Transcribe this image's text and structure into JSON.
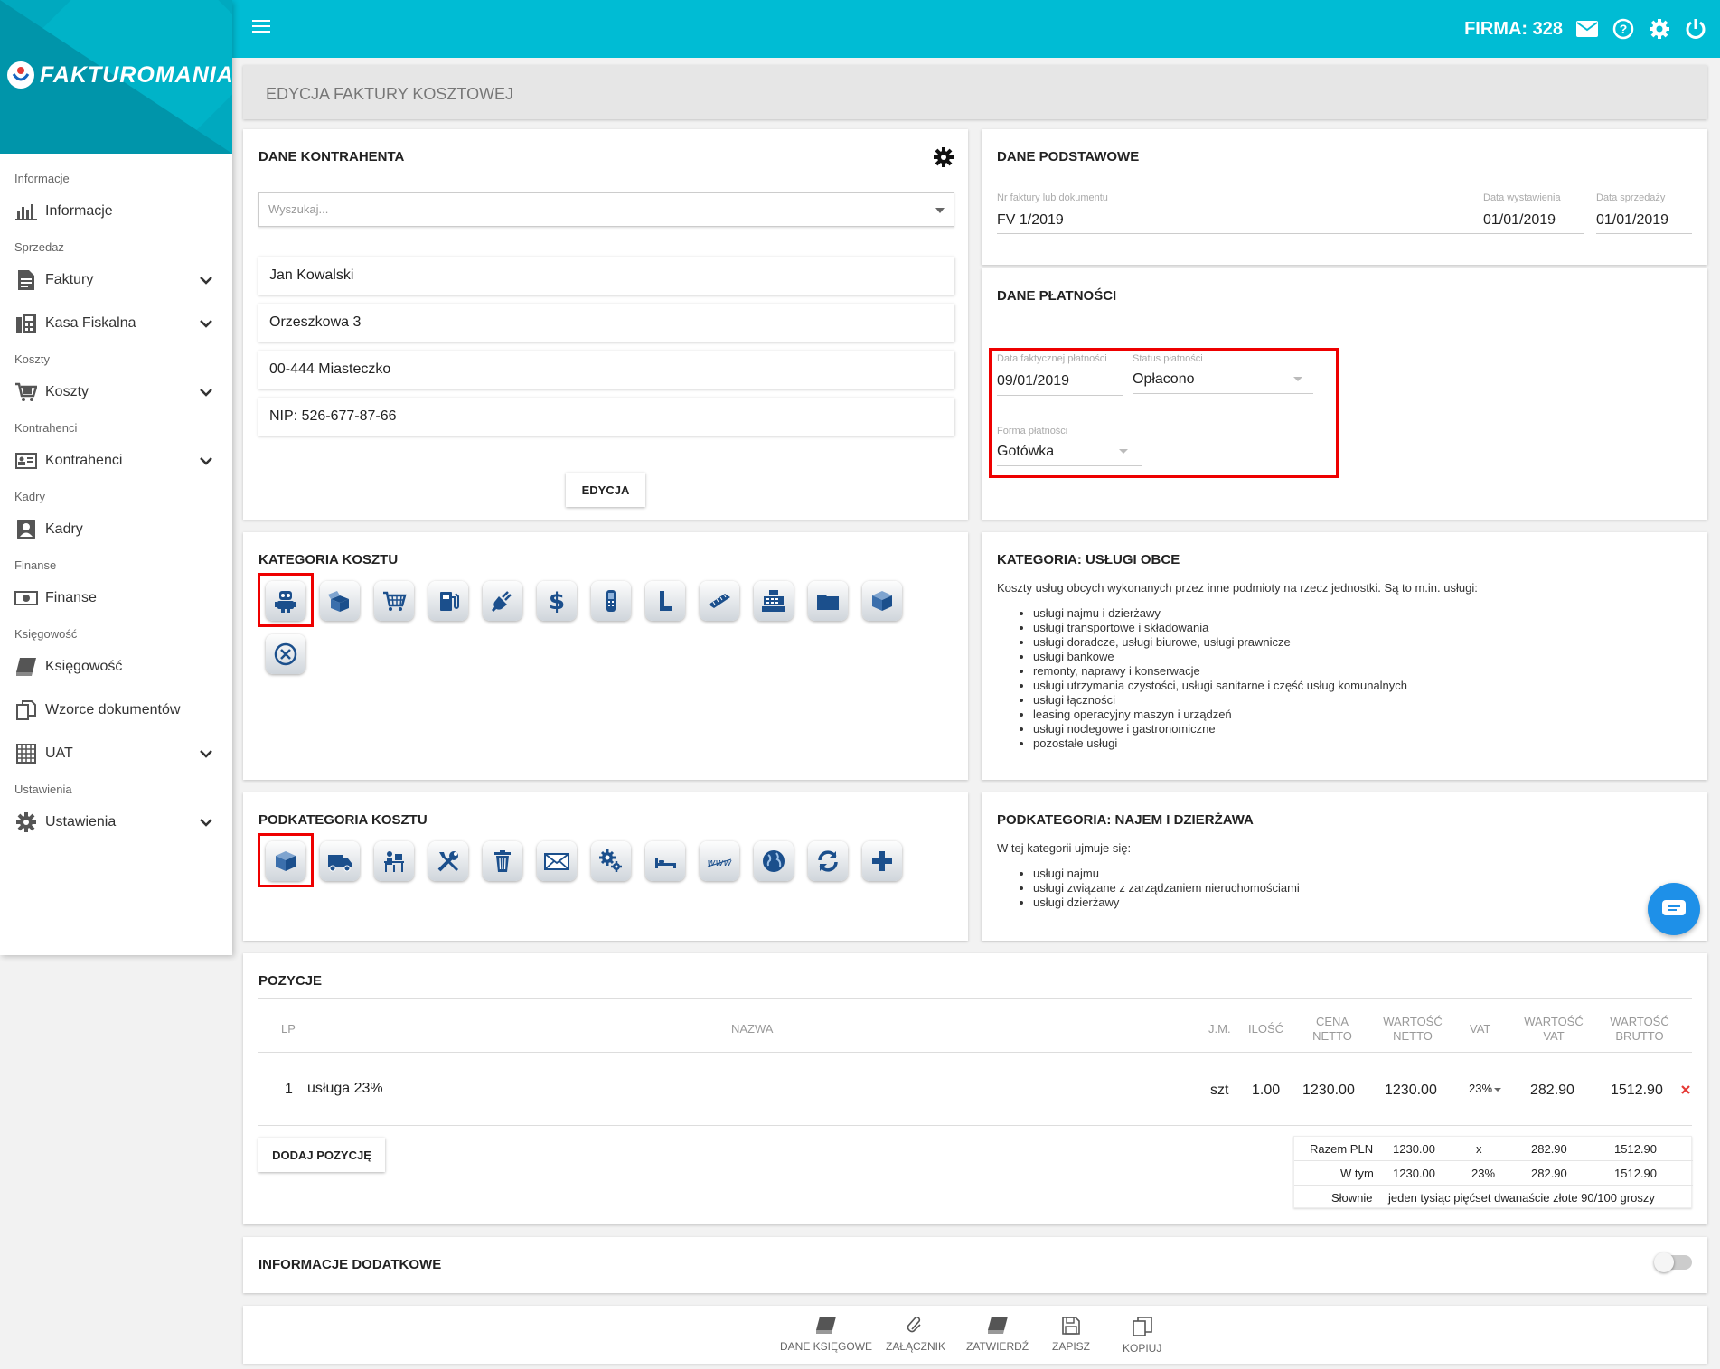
{
  "header": {
    "firma": "FIRMA: 328"
  },
  "brand": {
    "name": "FAKTUROMANIA"
  },
  "sidebar": {
    "sections": {
      "informacje": "Informacje",
      "sprzedaz": "Sprzedaż",
      "koszty": "Koszty",
      "kontrahenci": "Kontrahenci",
      "kadry": "Kadry",
      "finanse": "Finanse",
      "ksiegowosc": "Księgowość",
      "ustawienia": "Ustawienia"
    },
    "items": {
      "informacje": "Informacje",
      "faktury": "Faktury",
      "kasa": "Kasa Fiskalna",
      "koszty": "Koszty",
      "kontrahenci": "Kontrahenci",
      "kadry": "Kadry",
      "finanse": "Finanse",
      "ksiegowosc": "Księgowość",
      "wzorce": "Wzorce dokumentów",
      "uat": "UAT",
      "ustawienia": "Ustawienia"
    }
  },
  "page": {
    "title": "EDYCJA FAKTURY KOSZTOWEJ"
  },
  "kontrahent": {
    "title": "DANE KONTRAHENTA",
    "search_placeholder": "Wyszukaj...",
    "name": "Jan Kowalski",
    "street": "Orzeszkowa 3",
    "city": "00-444 Miasteczko",
    "nip": "NIP: 526-677-87-66",
    "edit_button": "EDYCJA"
  },
  "podstawowe": {
    "title": "DANE PODSTAWOWE",
    "nr_label": "Nr faktury lub dokumentu",
    "nr_value": "FV 1/2019",
    "wyst_label": "Data wystawienia",
    "wyst_value": "01/01/2019",
    "sprz_label": "Data sprzedaży",
    "sprz_value": "01/01/2019"
  },
  "platnosci": {
    "title": "DANE PŁATNOŚCI",
    "data_label": "Data faktycznej płatności",
    "data_value": "09/01/2019",
    "status_label": "Status płatności",
    "status_value": "Opłacono",
    "forma_label": "Forma płatności",
    "forma_value": "Gotówka"
  },
  "kategoria": {
    "title": "KATEGORIA KOSZTU",
    "icons": [
      "robot-icon",
      "box-open-icon",
      "cart-icon",
      "fuel-icon",
      "plug-icon",
      "dollar-icon",
      "phone-icon",
      "letter-l-icon",
      "ruler-icon",
      "cash-register-icon",
      "folder-icon",
      "box-icon",
      "cancel-icon"
    ]
  },
  "kategoria_opis": {
    "title": "KATEGORIA: USŁUGI OBCE",
    "intro": "Koszty usług obcych wykonanych przez inne podmioty na rzecz jednostki. Są to m.in. usługi:",
    "items": [
      "usługi najmu i dzierżawy",
      "usługi transportowe i składowania",
      "usługi doradcze, usługi biurowe, usługi prawnicze",
      "usługi bankowe",
      "remonty, naprawy i konserwacje",
      "usługi utrzymania czystości, usługi sanitarne i część usług komunalnych",
      "usługi łączności",
      "leasing operacyjny maszyn i urządzeń",
      "usługi noclegowe i gastronomiczne",
      "pozostałe usługi"
    ]
  },
  "podkategoria": {
    "title": "PODKATEGORIA KOSZTU",
    "icons": [
      "box-icon",
      "truck-icon",
      "desk-icon",
      "tools-icon",
      "trash-icon",
      "mail-icon",
      "gears-icon",
      "bed-icon",
      "www-icon",
      "globe-icon",
      "refresh-icon",
      "plus-icon"
    ]
  },
  "podkategoria_opis": {
    "title": "PODKATEGORIA: NAJEM I DZIERŻAWA",
    "intro": "W tej kategorii ujmuje się:",
    "items": [
      "usługi najmu",
      "usługi związane z zarządzaniem nieruchomościami",
      "usługi dzierżawy"
    ]
  },
  "pozycje": {
    "title": "POZYCJE",
    "headers": {
      "lp": "LP",
      "nazwa": "NAZWA",
      "jm": "J.M.",
      "ilosc": "ILOŚĆ",
      "cena1": "CENA",
      "cena2": "NETTO",
      "wn1": "WARTOŚĆ",
      "wn2": "NETTO",
      "vat": "VAT",
      "wv1": "WARTOŚĆ",
      "wv2": "VAT",
      "wb1": "WARTOŚĆ",
      "wb2": "BRUTTO"
    },
    "row": {
      "lp": "1",
      "nazwa": "usługa 23%",
      "jm": "szt",
      "ilosc": "1.00",
      "cena": "1230.00",
      "wartosc_netto": "1230.00",
      "vat": "23%",
      "wartosc_vat": "282.90",
      "wartosc_brutto": "1512.90"
    },
    "add_button": "DODAJ POZYCJĘ",
    "summary": {
      "razem_label": "Razem PLN",
      "razem_netto": "1230.00",
      "razem_vat_rate": "x",
      "razem_vat": "282.90",
      "razem_brutto": "1512.90",
      "wtym_label": "W tym",
      "wtym_netto": "1230.00",
      "wtym_rate": "23%",
      "wtym_vat": "282.90",
      "wtym_brutto": "1512.90",
      "slownie_label": "Słownie",
      "slownie_value": "jeden tysiąc pięćset dwanaście złote 90/100 groszy"
    }
  },
  "info": {
    "title": "INFORMACJE DODATKOWE"
  },
  "actions": {
    "dane": "DANE KSIĘGOWE",
    "zalacznik": "ZAŁĄCZNIK",
    "zatwierdz": "ZATWIERDŹ",
    "zapisz": "ZAPISZ",
    "kopiuj": "KOPIUJ"
  },
  "colors": {
    "accent": "#00bcd4",
    "highlight": "#e00000",
    "icon_blue": "#1b4f8c"
  }
}
